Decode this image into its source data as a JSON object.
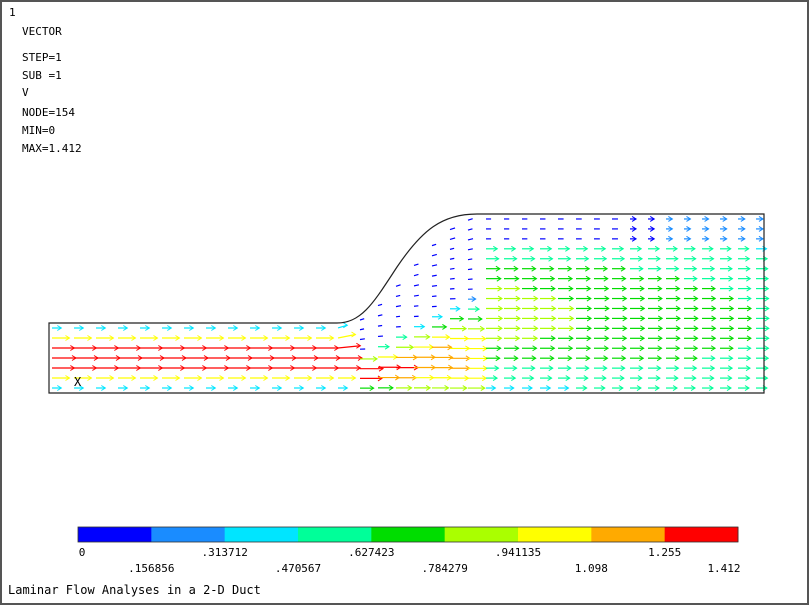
{
  "window_number": "1",
  "legend_block": {
    "mode": "VECTOR",
    "step": "STEP=1",
    "sub": "SUB =1",
    "quantity": "V",
    "node": "NODE=154",
    "min": "MIN=0",
    "max": "MAX=1.412"
  },
  "axis_marker": "X",
  "colorbar": {
    "labels_top": [
      "0",
      ".313712",
      ".627423",
      ".941135",
      "1.255"
    ],
    "labels_bottom": [
      ".156856",
      ".470567",
      ".784279",
      "1.098",
      "1.412"
    ],
    "colors": [
      "#0000ff",
      "#1a8cff",
      "#00e5ff",
      "#00ff99",
      "#00dd00",
      "#aaff00",
      "#ffff00",
      "#ffaa00",
      "#ff0000"
    ]
  },
  "caption": "Laminar Flow Analyses in a 2-D Duct",
  "chart_data": {
    "type": "vector_field",
    "quantity": "V",
    "min": 0,
    "max": 1.412,
    "node": 154,
    "levels": [
      0,
      0.156856,
      0.313712,
      0.470567,
      0.627423,
      0.784279,
      0.941135,
      1.098,
      1.255,
      1.412
    ]
  }
}
